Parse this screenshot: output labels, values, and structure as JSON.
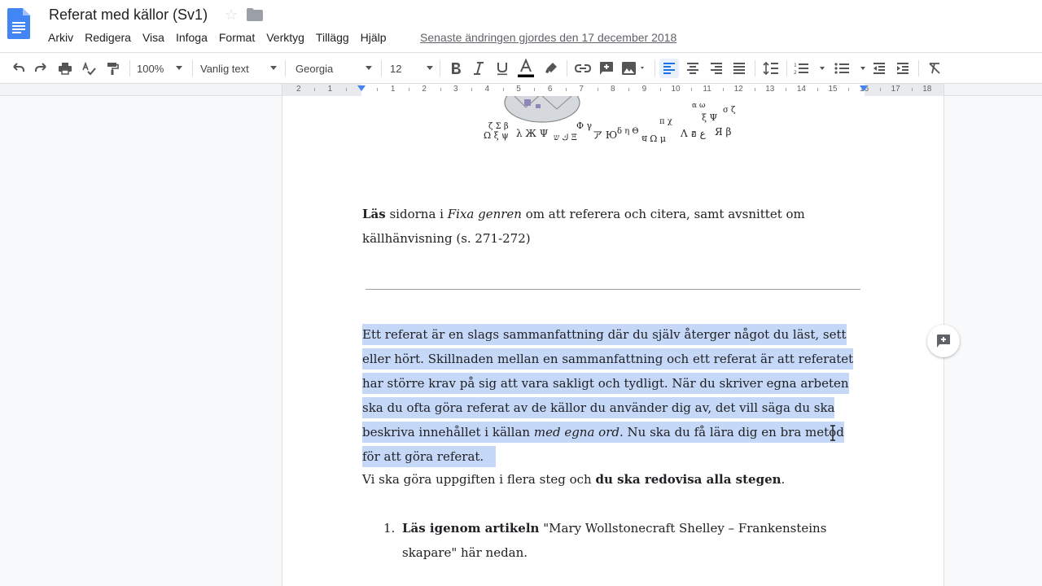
{
  "header": {
    "title": "Referat med källor (Sv1)",
    "last_edit": "Senaste ändringen gjordes den 17 december 2018",
    "menu": [
      "Arkiv",
      "Redigera",
      "Visa",
      "Infoga",
      "Format",
      "Verktyg",
      "Tillägg",
      "Hjälp"
    ]
  },
  "toolbar": {
    "zoom": "100%",
    "style": "Vanlig text",
    "font": "Georgia",
    "font_size": "12",
    "text_color": "#000000",
    "accent": "#1a73e8",
    "icons": [
      "undo-icon",
      "redo-icon",
      "print-icon",
      "spellcheck-icon",
      "paint-format-icon",
      "bold-icon",
      "italic-icon",
      "underline-icon",
      "text-color-icon",
      "highlight-icon",
      "link-icon",
      "add-comment-icon",
      "image-icon",
      "align-left-icon",
      "align-center-icon",
      "align-right-icon",
      "justify-icon",
      "line-spacing-icon",
      "numbered-list-icon",
      "bulleted-list-icon",
      "decrease-indent-icon",
      "increase-indent-icon",
      "clear-formatting-icon"
    ]
  },
  "ruler": {
    "left_numbers": [
      "2",
      "1"
    ],
    "right_numbers": [
      "1",
      "2",
      "3",
      "4",
      "5",
      "6",
      "7",
      "8",
      "9",
      "10",
      "11",
      "12",
      "13",
      "14",
      "15",
      "16",
      "17",
      "18"
    ]
  },
  "document": {
    "p1": {
      "bold": "Läs",
      "t1": " sidorna i ",
      "italic": "Fixa genren",
      "t2": " om att referera och citera, samt avsnittet om källhänvisning (s. 271-272)"
    },
    "p2": {
      "t1": "Ett referat är en slags sammanfattning där du själv återger något du läst, sett eller hört. Skillnaden mellan en sammanfattning och ett referat är att referatet har större krav på sig att vara sakligt och tydligt. När du skriver egna arbeten ska du ofta göra referat av de källor du använder dig av, det vill säga du ska beskriva innehållet i källan ",
      "italic": "med egna ord",
      "t2": ". Nu ska du få lära dig en bra metod för att göra referat."
    },
    "p3": {
      "t1": "Vi ska göra uppgiften i flera steg och ",
      "bold": "du ska redovisa alla stegen",
      "t2": "."
    },
    "list": [
      {
        "num": "1.",
        "bold": "Läs igenom artikeln",
        "text": " \"Mary Wollstonecraft Shelley – Frankensteins skapare\" här nedan."
      }
    ]
  },
  "colors": {
    "selection": "#c6d8f8",
    "docs_blue": "#4285f4"
  }
}
